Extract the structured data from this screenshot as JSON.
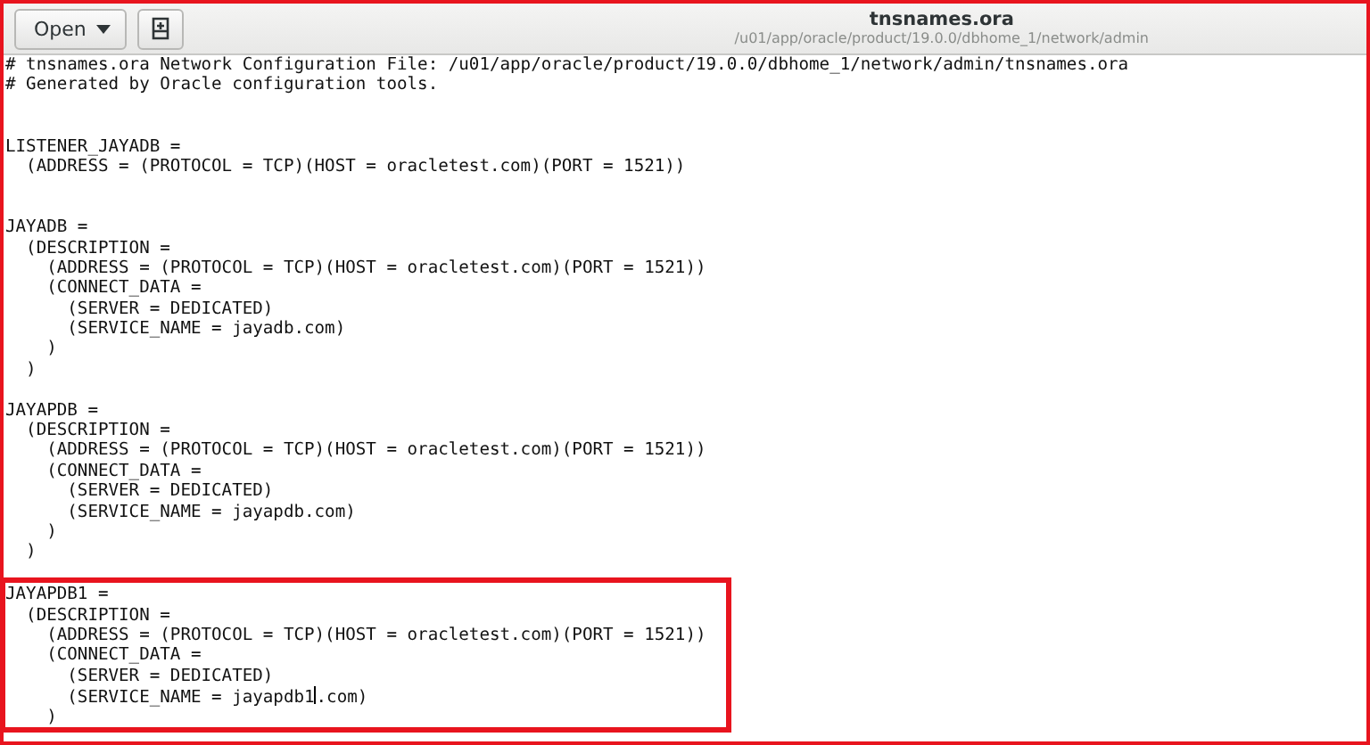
{
  "toolbar": {
    "open_button": {
      "label": "Open"
    }
  },
  "window": {
    "title": "tnsnames.ora",
    "subtitle": "/u01/app/oracle/product/19.0.0/dbhome_1/network/admin"
  },
  "editor": {
    "lines": [
      {
        "text": "# tnsnames.ora Network Configuration File: /u01/app/oracle/product/19.0.0/dbhome_1/network/admin/tnsnames.ora"
      },
      {
        "text": "# Generated by Oracle configuration tools."
      },
      {
        "kind": "blank"
      },
      {
        "kind": "blank"
      },
      {
        "text": "LISTENER_JAYADB ="
      },
      {
        "text": "  (ADDRESS = (PROTOCOL = TCP)(HOST = oracletest.com)(PORT = 1521))"
      },
      {
        "kind": "blank"
      },
      {
        "kind": "blank"
      },
      {
        "text": "JAYADB ="
      },
      {
        "text": "  (DESCRIPTION ="
      },
      {
        "text": "    (ADDRESS = (PROTOCOL = TCP)(HOST = oracletest.com)(PORT = 1521))"
      },
      {
        "text": "    (CONNECT_DATA ="
      },
      {
        "text": "      (SERVER = DEDICATED)"
      },
      {
        "text": "      (SERVICE_NAME = jayadb.com)"
      },
      {
        "text": "    )"
      },
      {
        "text": "  )"
      },
      {
        "kind": "blank"
      },
      {
        "text": "JAYAPDB ="
      },
      {
        "text": "  (DESCRIPTION ="
      },
      {
        "text": "    (ADDRESS = (PROTOCOL = TCP)(HOST = oracletest.com)(PORT = 1521))"
      },
      {
        "text": "    (CONNECT_DATA ="
      },
      {
        "text": "      (SERVER = DEDICATED)"
      },
      {
        "text": "      (SERVICE_NAME = jayapdb.com)"
      },
      {
        "text": "    )"
      },
      {
        "text": "  )"
      },
      {
        "kind": "blank"
      }
    ],
    "highlight": {
      "lines": [
        {
          "text": "JAYAPDB1 ="
        },
        {
          "text": "  (DESCRIPTION ="
        },
        {
          "text": "    (ADDRESS = (PROTOCOL = TCP)(HOST = oracletest.com)(PORT = 1521))"
        },
        {
          "text": "    (CONNECT_DATA ="
        },
        {
          "text": "      (SERVER = DEDICATED)"
        },
        {
          "kind": "cursor",
          "before": "      (SERVICE_NAME = jayapdb1",
          "after": ".com)"
        },
        {
          "text": "    )"
        }
      ]
    }
  }
}
